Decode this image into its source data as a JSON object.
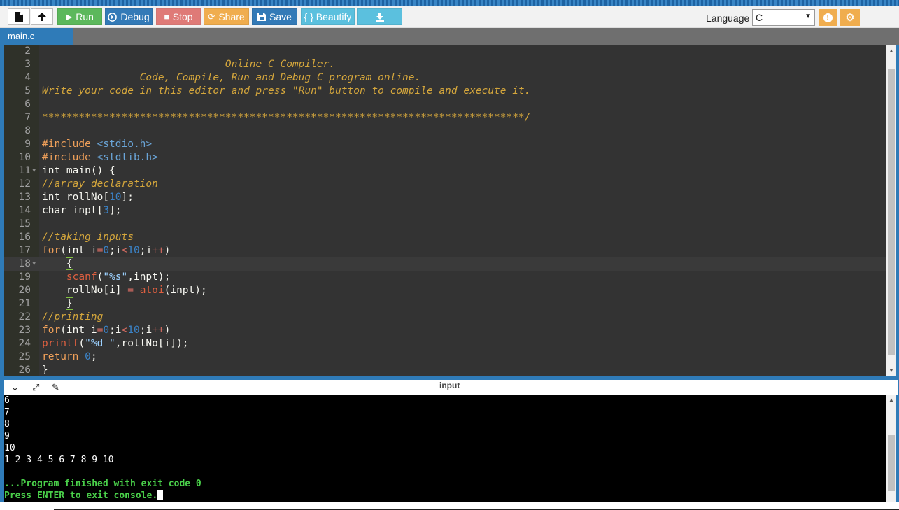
{
  "toolbar": {
    "run": "Run",
    "debug": "Debug",
    "stop": "Stop",
    "share": "Share",
    "save": "Save",
    "beautify": "{ } Beautify",
    "language_label": "Language",
    "language_value": "C"
  },
  "icons": {
    "new": "new-file-icon",
    "upload": "upload-icon",
    "download": "download-icon",
    "info": "info-icon",
    "settings": "gear-icon"
  },
  "tab": {
    "filename": "main.c"
  },
  "editor": {
    "lines": [
      {
        "n": "2",
        "text": ""
      },
      {
        "n": "3",
        "text": "                              Online C Compiler."
      },
      {
        "n": "4",
        "text": "                Code, Compile, Run and Debug C program online."
      },
      {
        "n": "5",
        "text": "Write your code in this editor and press \"Run\" button to compile and execute it."
      },
      {
        "n": "6",
        "text": ""
      },
      {
        "n": "7",
        "text": "*******************************************************************************/"
      },
      {
        "n": "8",
        "text": ""
      },
      {
        "n": "9",
        "text": "#include <stdio.h>"
      },
      {
        "n": "10",
        "text": "#include <stdlib.h>"
      },
      {
        "n": "11",
        "text": "int main() {"
      },
      {
        "n": "12",
        "text": "//array declaration"
      },
      {
        "n": "13",
        "text": "int rollNo[10];"
      },
      {
        "n": "14",
        "text": "char inpt[3];"
      },
      {
        "n": "15",
        "text": ""
      },
      {
        "n": "16",
        "text": "//taking inputs"
      },
      {
        "n": "17",
        "text": "for(int i=0;i<10;i++)"
      },
      {
        "n": "18",
        "text": "    {"
      },
      {
        "n": "19",
        "text": "    scanf(\"%s\",inpt);"
      },
      {
        "n": "20",
        "text": "    rollNo[i] = atoi(inpt);"
      },
      {
        "n": "21",
        "text": "    }"
      },
      {
        "n": "22",
        "text": "//printing"
      },
      {
        "n": "23",
        "text": "for(int i=0;i<10;i++)"
      },
      {
        "n": "24",
        "text": "printf(\"%d \",rollNo[i]);"
      },
      {
        "n": "25",
        "text": "return 0;"
      },
      {
        "n": "26",
        "text": "}"
      }
    ]
  },
  "console": {
    "title": "input",
    "lines": [
      "6",
      "7",
      "8",
      "9",
      "10",
      "1 2 3 4 5 6 7 8 9 10",
      ""
    ],
    "status": "...Program finished with exit code 0",
    "prompt": "Press ENTER to exit console."
  },
  "colors": {
    "run": "#5cb85c",
    "debug": "#337ab7",
    "stop": "#d9534f",
    "share": "#f0ad4e",
    "beautify": "#5bc0de",
    "editor_bg": "#333333",
    "console_text_green": "#4ad04a"
  }
}
